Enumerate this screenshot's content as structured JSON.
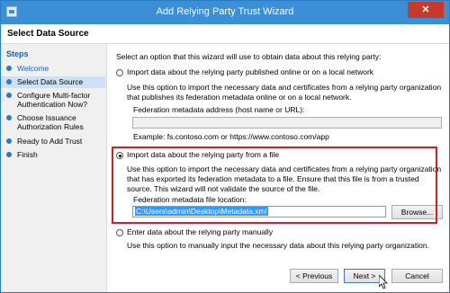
{
  "window": {
    "title": "Add Relying Party Trust Wizard",
    "close_glyph": "✕"
  },
  "header": {
    "title": "Select Data Source"
  },
  "steps": {
    "title": "Steps",
    "items": [
      {
        "label": "Welcome",
        "state": "link"
      },
      {
        "label": "Select Data Source",
        "state": "current"
      },
      {
        "label": "Configure Multi-factor Authentication Now?",
        "state": "pending"
      },
      {
        "label": "Choose Issuance Authorization Rules",
        "state": "pending"
      },
      {
        "label": "Ready to Add Trust",
        "state": "pending"
      },
      {
        "label": "Finish",
        "state": "pending"
      }
    ]
  },
  "main": {
    "intro": "Select an option that this wizard will use to obtain data about this relying party:",
    "option_online": {
      "label": "Import data about the relying party published online or on a local network",
      "description": "Use this option to import the necessary data and certificates from a relying party organization that publishes its federation metadata online or on a local network.",
      "field_label": "Federation metadata address (host name or URL):",
      "field_value": "",
      "example": "Example: fs.contoso.com or https://www.contoso.com/app",
      "checked": false
    },
    "option_file": {
      "label": "Import data about the relying party from a file",
      "description": "Use this option to import the necessary data and certificates from a relying party organization that has exported its federation metadata to a file. Ensure that this file is from a trusted source.  This wizard will not validate the source of the file.",
      "field_label": "Federation metadata file location:",
      "field_value": "C:\\Users\\admin\\Desktop\\Metadata.xml",
      "browse_label": "Browse...",
      "checked": true
    },
    "option_manual": {
      "label": "Enter data about the relying party manually",
      "description": "Use this option to manually input the necessary data about this relying party organization.",
      "checked": false
    }
  },
  "footer": {
    "previous_label": "< Previous",
    "next_label": "Next >",
    "cancel_label": "Cancel"
  },
  "colors": {
    "titlebar": "#3a8fd6",
    "highlight": "#d31f26",
    "link": "#1a67c4",
    "selection": "#3399ff"
  }
}
